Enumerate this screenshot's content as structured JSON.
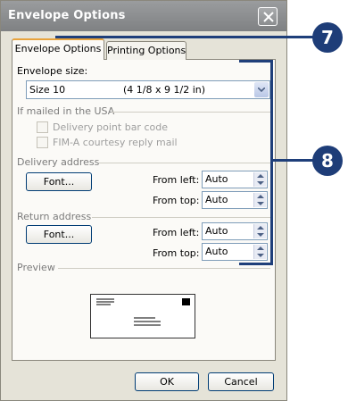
{
  "dialog": {
    "title": "Envelope Options",
    "close_icon": "close-icon"
  },
  "tabs": [
    {
      "label": "Envelope Options",
      "active": true
    },
    {
      "label": "Printing Options",
      "active": false
    }
  ],
  "envelope_size": {
    "label": "Envelope size:",
    "selected_name": "Size 10",
    "selected_dims": "(4 1/8 x 9 1/2 in)"
  },
  "usa": {
    "group_label": "If mailed in the USA",
    "delivery_barcode_label": "Delivery point bar code",
    "fim_label": "FIM-A courtesy reply mail"
  },
  "delivery_address": {
    "group_label": "Delivery address",
    "font_button": "Font...",
    "from_left_label": "From left:",
    "from_left_value": "Auto",
    "from_top_label": "From top:",
    "from_top_value": "Auto"
  },
  "return_address": {
    "group_label": "Return address",
    "font_button": "Font...",
    "from_left_label": "From left:",
    "from_left_value": "Auto",
    "from_top_label": "From top:",
    "from_top_value": "Auto"
  },
  "preview": {
    "group_label": "Preview"
  },
  "footer": {
    "ok_label": "OK",
    "cancel_label": "Cancel"
  },
  "callouts": {
    "step7": "7",
    "step8": "8",
    "color": "#1e3d78"
  }
}
